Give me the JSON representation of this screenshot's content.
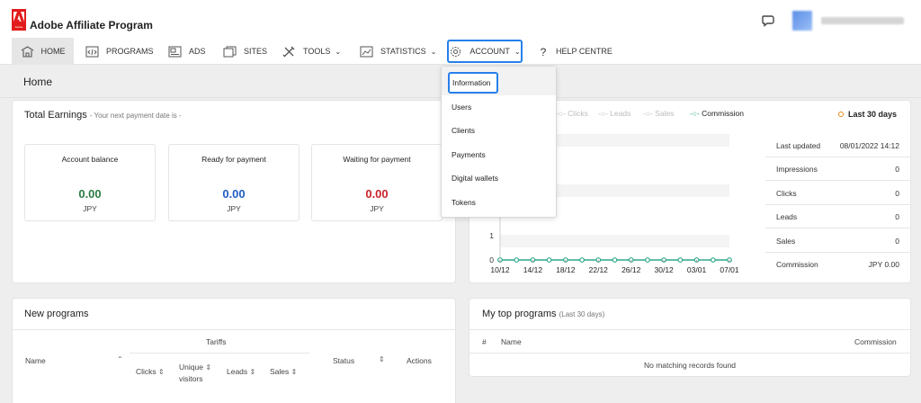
{
  "app": {
    "title": "Adobe Affiliate Program",
    "logo_text": "Adobe"
  },
  "nav": [
    {
      "label": "HOME",
      "icon": "home-icon"
    },
    {
      "label": "PROGRAMS",
      "icon": "code-window-icon"
    },
    {
      "label": "ADS",
      "icon": "image-icon"
    },
    {
      "label": "SITES",
      "icon": "windows-icon"
    },
    {
      "label": "TOOLS",
      "icon": "tools-icon",
      "chevron": "⌄"
    },
    {
      "label": "STATISTICS",
      "icon": "statistics-icon",
      "chevron": "⌄"
    },
    {
      "label": "ACCOUNT",
      "icon": "gear-icon",
      "chevron": "⌄"
    },
    {
      "label": "HELP CENTRE",
      "icon": "question-icon"
    }
  ],
  "page": {
    "title": "Home"
  },
  "earnings": {
    "title": "Total Earnings",
    "subtitle": "- Your next payment date is -",
    "boxes": [
      {
        "label": "Account balance",
        "value": "0.00",
        "currency": "JPY",
        "color": "#2d7d46"
      },
      {
        "label": "Ready for payment",
        "value": "0.00",
        "currency": "JPY",
        "color": "#1f5fc4"
      },
      {
        "label": "Waiting for payment",
        "value": "0.00",
        "currency": "JPY",
        "color": "#c9252c"
      }
    ]
  },
  "chart": {
    "legend": [
      "Clicks",
      "Leads",
      "Sales",
      "Commission"
    ],
    "period": "Last 30 days",
    "period_color": "#e68619",
    "series_color": "#2ea88a"
  },
  "chart_data": {
    "type": "line",
    "x": [
      "10/12",
      "14/12",
      "18/12",
      "22/12",
      "26/12",
      "30/12",
      "03/01",
      "07/01"
    ],
    "yticks": [
      "0",
      "1"
    ],
    "series": [
      {
        "name": "Commission",
        "values": [
          0,
          0,
          0,
          0,
          0,
          0,
          0,
          0,
          0,
          0,
          0,
          0,
          0,
          0,
          0
        ]
      }
    ]
  },
  "stats": [
    {
      "label": "Last updated",
      "value": "08/01/2022 14:12"
    },
    {
      "label": "Impressions",
      "value": "0"
    },
    {
      "label": "Clicks",
      "value": "0"
    },
    {
      "label": "Leads",
      "value": "0"
    },
    {
      "label": "Sales",
      "value": "0"
    },
    {
      "label": "Commission",
      "value": "JPY 0.00"
    }
  ],
  "account_menu": [
    "Information",
    "Users",
    "Clients",
    "Payments",
    "Digital wallets",
    "Tokens"
  ],
  "new_programs": {
    "title": "New programs",
    "columns": {
      "name": "Name",
      "tariffs": "Tariffs",
      "clicks": "Clicks",
      "unique1": "Unique",
      "unique2": "visitors",
      "leads": "Leads",
      "sales": "Sales",
      "status": "Status",
      "actions": "Actions"
    }
  },
  "top_programs": {
    "title": "My top programs",
    "subtitle": "(Last 30 days)",
    "columns": {
      "hash": "#",
      "name": "Name",
      "commission": "Commission"
    },
    "empty": "No matching records found"
  }
}
